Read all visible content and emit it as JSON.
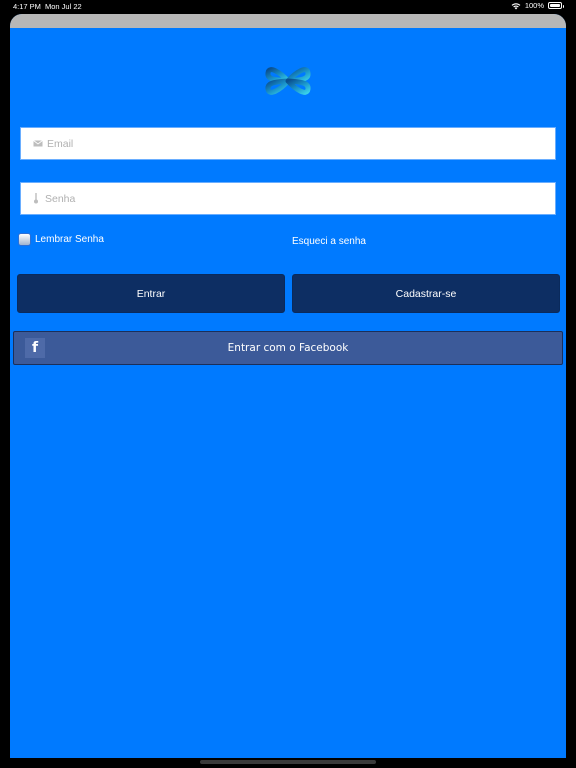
{
  "status_bar": {
    "time": "4:17 PM",
    "date": "Mon Jul 22",
    "battery": "100%"
  },
  "login": {
    "email_placeholder": "Email",
    "password_placeholder": "Senha",
    "remember_label": "Lembrar Senha",
    "forgot_label": "Esqueci a senha",
    "login_button": "Entrar",
    "register_button": "Cadastrar-se",
    "facebook_button": "Entrar com o Facebook"
  },
  "icons": {
    "email": "mail-icon",
    "password": "key-icon",
    "facebook": "facebook-icon"
  },
  "colors": {
    "background": "#007aff",
    "button": "#0d2e63",
    "facebook": "#3c5a99"
  }
}
